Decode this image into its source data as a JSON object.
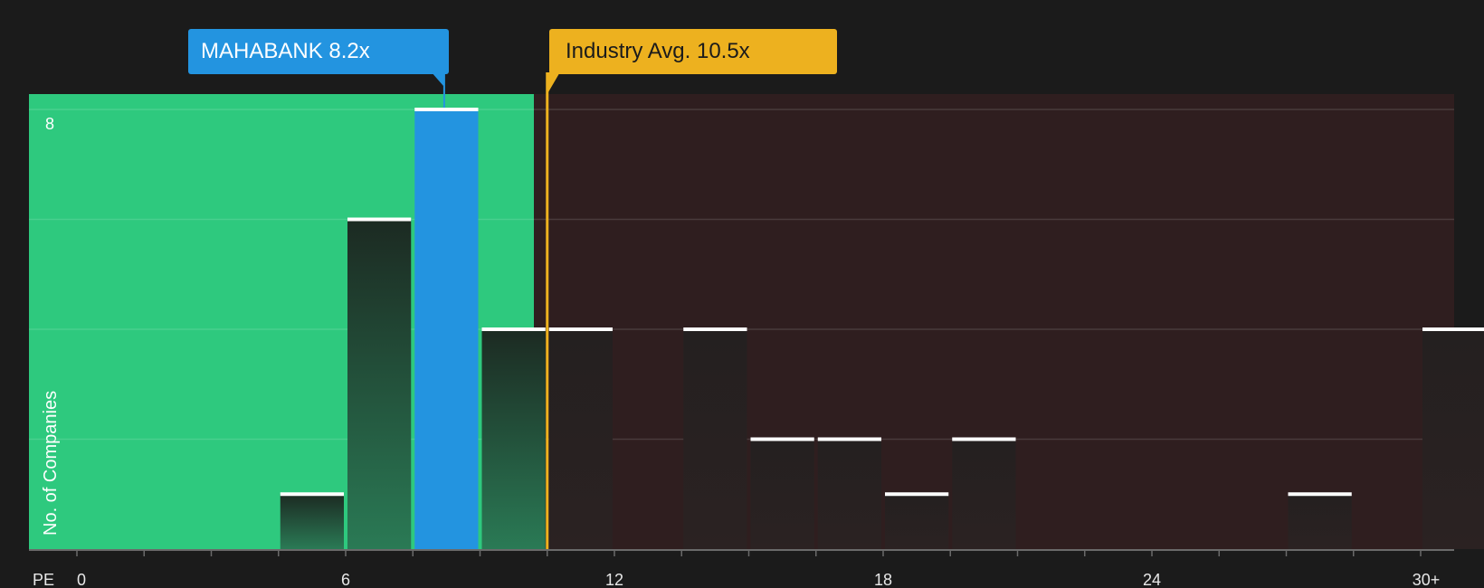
{
  "callouts": {
    "company": "MAHABANK 8.2x",
    "industry": "Industry Avg. 10.5x"
  },
  "colors": {
    "background": "#1b1b1b",
    "undervalued_zone": "#2ec97e",
    "overvalued_zone": "#2f1e1f",
    "company": "#2394e0",
    "industry": "#edb11f"
  },
  "chart_data": {
    "type": "bar",
    "xlabel": "PE",
    "ylabel": "No. of Companies",
    "x_ticks": [
      "0",
      "6",
      "12",
      "18",
      "24",
      "30+"
    ],
    "x_tick_values": [
      0,
      6,
      12,
      18,
      24,
      30
    ],
    "xlim": [
      0,
      30.8
    ],
    "y_ticks": [
      "8"
    ],
    "y_tick_values": [
      8
    ],
    "ylim": [
      0,
      8.3
    ],
    "bin_width": 1.5,
    "bins": [
      {
        "x_start": 4.5,
        "value": 1
      },
      {
        "x_start": 6.0,
        "value": 6
      },
      {
        "x_start": 7.5,
        "value": 8,
        "highlight": true
      },
      {
        "x_start": 9.0,
        "value": 4
      },
      {
        "x_start": 10.5,
        "value": 4
      },
      {
        "x_start": 13.5,
        "value": 4
      },
      {
        "x_start": 15.0,
        "value": 2
      },
      {
        "x_start": 16.5,
        "value": 2
      },
      {
        "x_start": 18.0,
        "value": 1
      },
      {
        "x_start": 19.5,
        "value": 2
      },
      {
        "x_start": 27.0,
        "value": 1
      },
      {
        "x_start": 30.0,
        "value": 4
      }
    ],
    "company_pe": 8.2,
    "industry_avg_pe": 10.5,
    "undervalued_until": 10.0,
    "grid": true
  }
}
